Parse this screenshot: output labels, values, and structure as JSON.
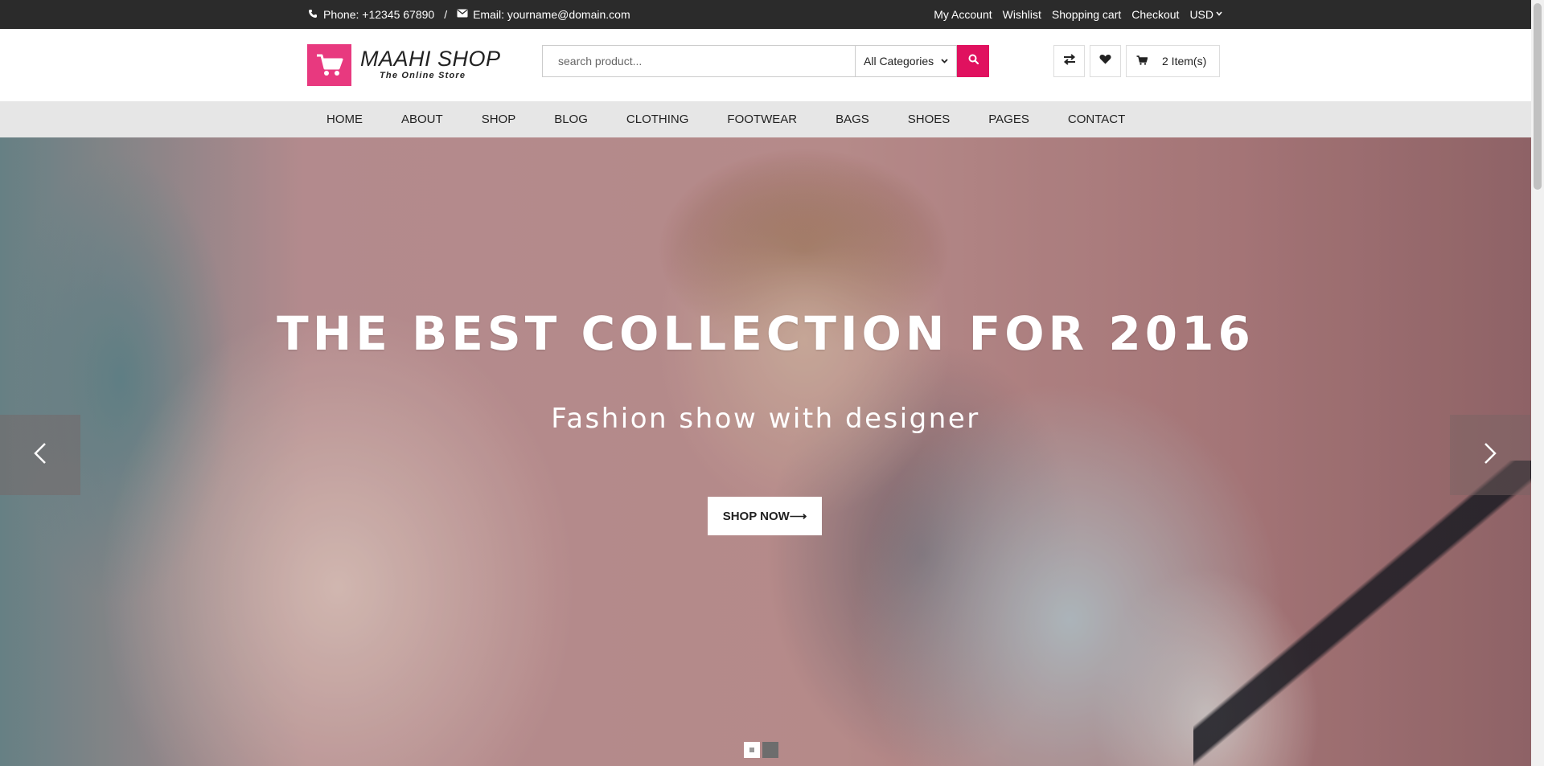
{
  "topbar": {
    "phone": "Phone: +12345 67890",
    "separator": "/",
    "email": "Email: yourname@domain.com",
    "links": [
      "My Account",
      "Wishlist",
      "Shopping cart",
      "Checkout"
    ],
    "currency": "USD"
  },
  "header": {
    "logo_title": "MAAHI SHOP",
    "logo_subtitle": "The Online Store",
    "search_placeholder": "search product...",
    "category": "All Categories",
    "cart_label": "2 Item(s)"
  },
  "nav": {
    "items": [
      "HOME",
      "ABOUT",
      "SHOP",
      "BLOG",
      "CLOTHING",
      "FOOTWEAR",
      "BAGS",
      "SHOES",
      "PAGES",
      "CONTACT"
    ]
  },
  "hero": {
    "title": "THE BEST COLLECTION FOR 2016",
    "subtitle": "Fashion show with designer",
    "cta": "SHOP NOW⟶",
    "slides": 2,
    "active_slide": 1
  },
  "colors": {
    "accent": "#e0115f",
    "logo": "#e8397f",
    "topbar": "#2b2b2b",
    "nav": "#e6e6e6"
  },
  "icons": {
    "phone": "phone-icon",
    "email": "envelope-icon",
    "search": "search-icon",
    "compare": "exchange-icon",
    "wishlist": "heart-icon",
    "cart": "cart-icon",
    "prev": "chevron-left-icon",
    "next": "chevron-right-icon"
  }
}
